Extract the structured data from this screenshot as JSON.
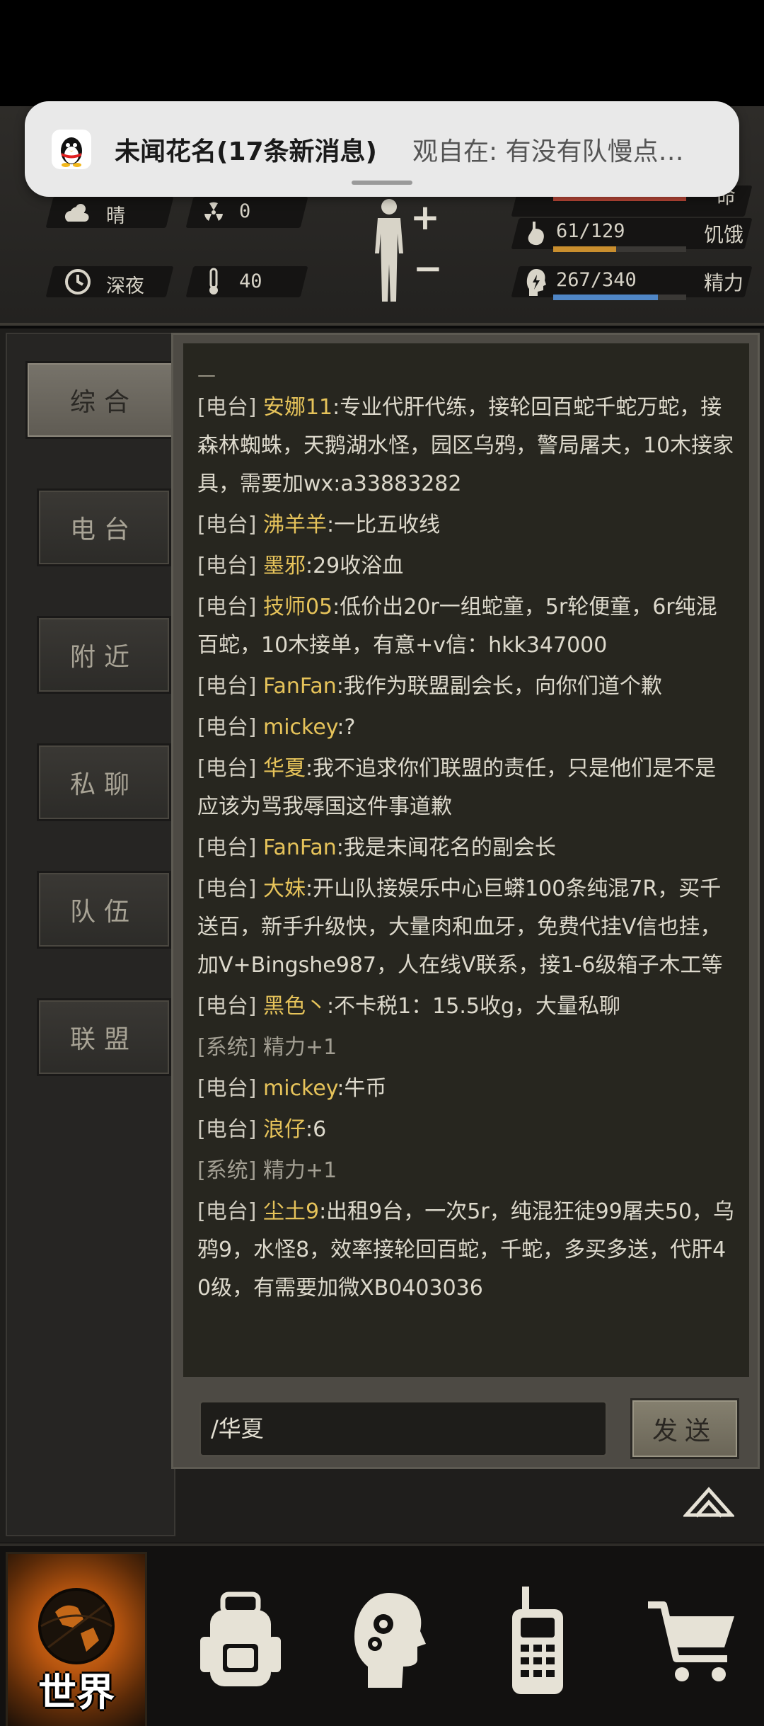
{
  "status": {
    "weather_label": "晴",
    "radiation_value": "0",
    "time_label": "深夜",
    "temperature_value": "40",
    "hunger": {
      "label": "饥饿",
      "text": "61/129",
      "current": 61,
      "max": 129,
      "color": "#c98e2e"
    },
    "energy": {
      "label": "精力",
      "text": "267/340",
      "current": 267,
      "max": 340,
      "color": "#4f86c6"
    },
    "health_bar_color": "#c24a3a",
    "health_label_partial": "命"
  },
  "notification": {
    "title": "未闻花名(17条新消息)",
    "body": "观自在: 有没有队慢点…"
  },
  "tabs": [
    {
      "label": "综合",
      "active": true
    },
    {
      "label": "电台",
      "active": false
    },
    {
      "label": "附近",
      "active": false
    },
    {
      "label": "私聊",
      "active": false
    },
    {
      "label": "队伍",
      "active": false
    },
    {
      "label": "联盟",
      "active": false
    }
  ],
  "chat": {
    "top_marker": "—",
    "messages": [
      {
        "channel": "[电台]",
        "name": "安娜11",
        "text": ":专业代肝代练，接轮回百蛇千蛇万蛇，接森林蜘蛛，天鹅湖水怪，园区乌鸦，警局屠夫，10木接家具，需要加wx:a33883282",
        "system": false
      },
      {
        "channel": "[电台]",
        "name": "沸羊羊",
        "text": ":一比五收线",
        "system": false
      },
      {
        "channel": "[电台]",
        "name": "墨邪",
        "text": ":29收浴血",
        "system": false
      },
      {
        "channel": "[电台]",
        "name": "技师05",
        "text": ":低价出20r一组蛇童，5r轮便童，6r纯混百蛇，10木接单，有意+v信：hkk347000",
        "system": false
      },
      {
        "channel": "[电台]",
        "name": "FanFan",
        "text": ":我作为联盟副会长，向你们道个歉",
        "system": false
      },
      {
        "channel": "[电台]",
        "name": "mickey",
        "text": ":?",
        "system": false
      },
      {
        "channel": "[电台]",
        "name": "华夏",
        "text": ":我不追求你们联盟的责任，只是他们是不是应该为骂我辱国这件事道歉",
        "system": false
      },
      {
        "channel": "[电台]",
        "name": "FanFan",
        "text": ":我是未闻花名的副会长",
        "system": false
      },
      {
        "channel": "[电台]",
        "name": "大妹",
        "text": ":开山队接娱乐中心巨蟒100条纯混7R，买千送百，新手升级快，大量肉和血牙，免费代挂V信也挂，加V+Bingshe987，人在线V联系，接1-6级箱子木工等",
        "system": false
      },
      {
        "channel": "[电台]",
        "name": "黑色丶",
        "text": ":不卡税1：15.5收g，大量私聊",
        "system": false
      },
      {
        "channel": "[系统]",
        "name": "精力",
        "text": "+1",
        "system": true
      },
      {
        "channel": "[电台]",
        "name": "mickey",
        "text": ":牛币",
        "system": false
      },
      {
        "channel": "[电台]",
        "name": "浪仔",
        "text": ":6",
        "system": false
      },
      {
        "channel": "[系统]",
        "name": "精力",
        "text": "+1",
        "system": true
      },
      {
        "channel": "[电台]",
        "name": "尘土9",
        "text": ":出租9台，一次5r，纯混狂徒99屠夫50，乌鸦9，水怪8，效率接轮回百蛇，千蛇，多买多送，代肝40级，有需要加微XB0403036",
        "system": false
      }
    ],
    "input_value": "/华夏",
    "send_label": "发送"
  },
  "bottom_nav": {
    "world_label": "世界",
    "items": [
      "world-icon",
      "backpack-icon",
      "skills-icon",
      "radio-icon",
      "shop-cart-icon"
    ],
    "accent": "#e07b1f"
  }
}
